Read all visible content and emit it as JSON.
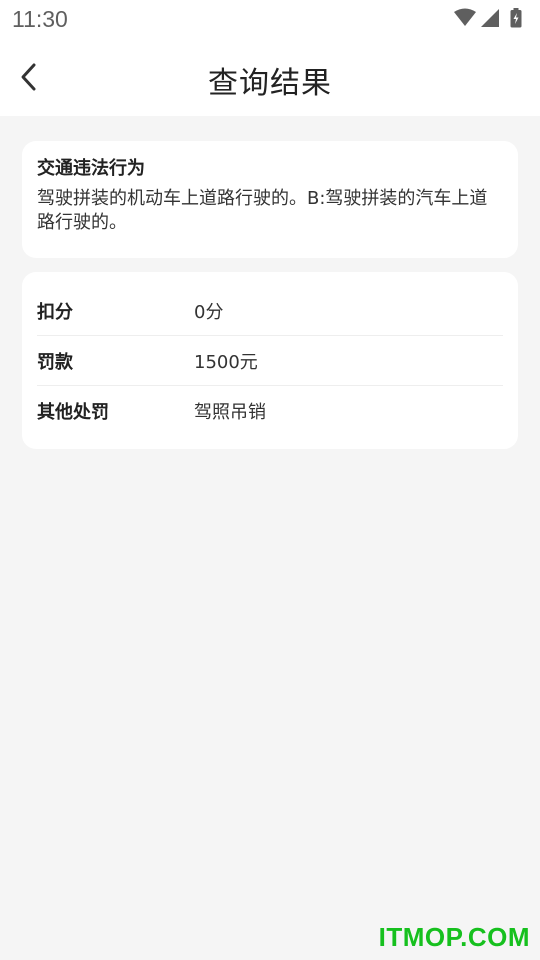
{
  "status_bar": {
    "time": "11:30",
    "icons": [
      "wifi-icon",
      "cellular-signal-icon",
      "battery-charging-icon"
    ]
  },
  "header": {
    "back_icon": "chevron-left-icon",
    "title": "查询结果"
  },
  "violation": {
    "heading": "交通违法行为",
    "description": "驾驶拼装的机动车上道路行驶的。B:驾驶拼装的汽车上道路行驶的。"
  },
  "penalties": [
    {
      "label": "扣分",
      "value": "0分"
    },
    {
      "label": "罚款",
      "value": "1500元"
    },
    {
      "label": "其他处罚",
      "value": "驾照吊销"
    }
  ],
  "watermark": "ITMOP.COM",
  "colors": {
    "background": "#f5f5f5",
    "card": "#ffffff",
    "watermark": "#16c01e"
  }
}
